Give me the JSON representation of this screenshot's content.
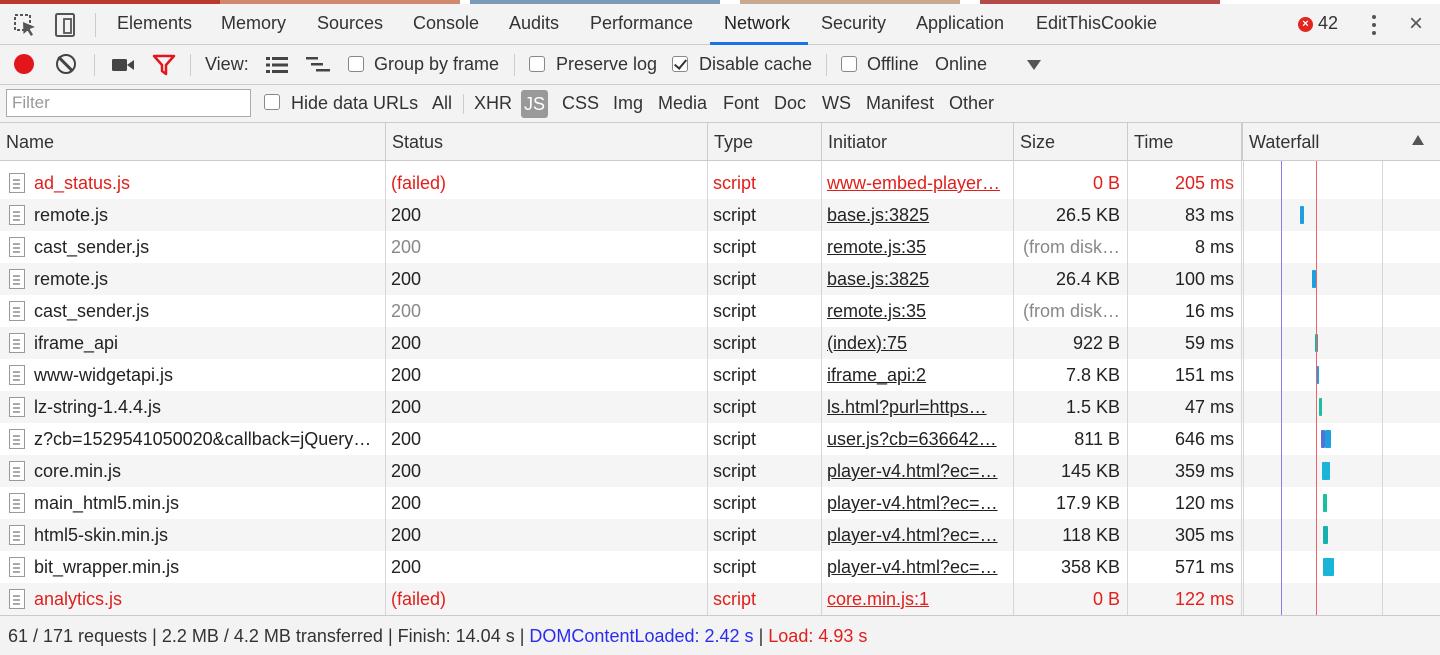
{
  "tabs": [
    {
      "label": "Elements"
    },
    {
      "label": "Memory"
    },
    {
      "label": "Sources"
    },
    {
      "label": "Console"
    },
    {
      "label": "Audits"
    },
    {
      "label": "Performance"
    },
    {
      "label": "Network"
    },
    {
      "label": "Security"
    },
    {
      "label": "Application"
    },
    {
      "label": "EditThisCookie"
    }
  ],
  "active_tab": "Network",
  "error_count": "42",
  "toolbar": {
    "view_label": "View:",
    "group_by_frame": {
      "label": "Group by frame",
      "checked": false
    },
    "preserve_log": {
      "label": "Preserve log",
      "checked": false
    },
    "disable_cache": {
      "label": "Disable cache",
      "checked": true
    },
    "offline": {
      "label": "Offline",
      "checked": false
    },
    "throttle": "Online"
  },
  "filterbar": {
    "placeholder": "Filter",
    "hide_data_urls": {
      "label": "Hide data URLs",
      "checked": false
    },
    "types": [
      "All",
      "XHR",
      "JS",
      "CSS",
      "Img",
      "Media",
      "Font",
      "Doc",
      "WS",
      "Manifest",
      "Other"
    ],
    "selected_type": "JS"
  },
  "columns": [
    "Name",
    "Status",
    "Type",
    "Initiator",
    "Size",
    "Time",
    "Waterfall"
  ],
  "rows": [
    {
      "name": "ad_status.js",
      "status": "(failed)",
      "type": "script",
      "initiator": "www-embed-player…",
      "size": "0 B",
      "time": "205 ms",
      "failed": true
    },
    {
      "name": "remote.js",
      "status": "200",
      "type": "script",
      "initiator": "base.js:3825",
      "size": "26.5 KB",
      "time": "83 ms"
    },
    {
      "name": "cast_sender.js",
      "status": "200",
      "type": "script",
      "initiator": "remote.js:35",
      "size": "(from disk…",
      "time": "8 ms",
      "cached": true
    },
    {
      "name": "remote.js",
      "status": "200",
      "type": "script",
      "initiator": "base.js:3825",
      "size": "26.4 KB",
      "time": "100 ms"
    },
    {
      "name": "cast_sender.js",
      "status": "200",
      "type": "script",
      "initiator": "remote.js:35",
      "size": "(from disk…",
      "time": "16 ms",
      "cached": true
    },
    {
      "name": "iframe_api",
      "status": "200",
      "type": "script",
      "initiator": "(index):75",
      "size": "922 B",
      "time": "59 ms"
    },
    {
      "name": "www-widgetapi.js",
      "status": "200",
      "type": "script",
      "initiator": "iframe_api:2",
      "size": "7.8 KB",
      "time": "151 ms"
    },
    {
      "name": "lz-string-1.4.4.js",
      "status": "200",
      "type": "script",
      "initiator": "ls.html?purl=https…",
      "size": "1.5 KB",
      "time": "47 ms"
    },
    {
      "name": "z?cb=1529541050020&callback=jQuery…",
      "status": "200",
      "type": "script",
      "initiator": "user.js?cb=636642…",
      "size": "811 B",
      "time": "646 ms"
    },
    {
      "name": "core.min.js",
      "status": "200",
      "type": "script",
      "initiator": "player-v4.html?ec=…",
      "size": "145 KB",
      "time": "359 ms"
    },
    {
      "name": "main_html5.min.js",
      "status": "200",
      "type": "script",
      "initiator": "player-v4.html?ec=…",
      "size": "17.9 KB",
      "time": "120 ms"
    },
    {
      "name": "html5-skin.min.js",
      "status": "200",
      "type": "script",
      "initiator": "player-v4.html?ec=…",
      "size": "118 KB",
      "time": "305 ms"
    },
    {
      "name": "bit_wrapper.min.js",
      "status": "200",
      "type": "script",
      "initiator": "player-v4.html?ec=…",
      "size": "358 KB",
      "time": "571 ms"
    },
    {
      "name": "analytics.js",
      "status": "(failed)",
      "type": "script",
      "initiator": "core.min.js:1",
      "size": "0 B",
      "time": "122 ms",
      "failed": true
    }
  ],
  "statusbar": {
    "requests": "61 / 171 requests",
    "transferred": "2.2 MB / 4.2 MB transferred",
    "finish": "Finish: 14.04 s",
    "dom_content_loaded": "DOMContentLoaded: 2.42 s",
    "load": "Load: 4.93 s",
    "sep": "|"
  },
  "colors": {
    "accent": "#1a73e8",
    "failed": "#e0201c",
    "dcl_line": "#8b7df0",
    "load_line": "#f0616a",
    "bar": "#1e9fe0",
    "bar_alt": "#16b0a0"
  }
}
